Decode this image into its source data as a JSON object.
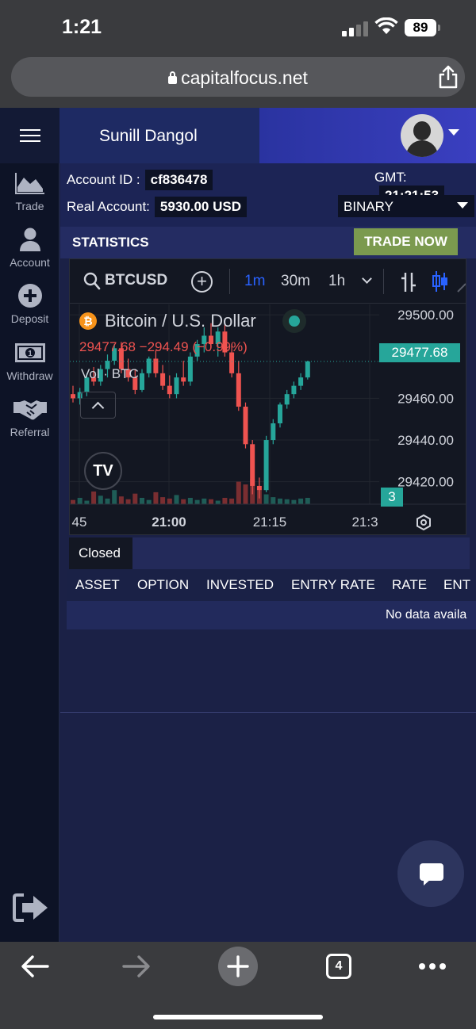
{
  "status_bar": {
    "time": "1:21",
    "battery": "89"
  },
  "browser": {
    "url": "capitalfocus.net"
  },
  "header": {
    "user_name": "Sunill Dangol"
  },
  "sidebar": {
    "items": [
      {
        "label": "Trade",
        "icon": "chart-area-icon"
      },
      {
        "label": "Account",
        "icon": "user-icon"
      },
      {
        "label": "Deposit",
        "icon": "plus-circle-icon"
      },
      {
        "label": "Withdraw",
        "icon": "banknote-icon"
      },
      {
        "label": "Referral",
        "icon": "handshake-icon"
      }
    ],
    "logout_icon": "logout-icon"
  },
  "account": {
    "id_label": "Account ID :",
    "id_value": "cf836478",
    "gmt_label": "GMT:",
    "gmt_value": "21:21:53",
    "real_label": "Real Account:",
    "real_value": "5930.00 USD",
    "mode": "BINARY"
  },
  "stats": {
    "title": "STATISTICS",
    "trade_now": "TRADE NOW"
  },
  "tv_toolbar": {
    "symbol": "BTCUSD",
    "intervals": [
      "1m",
      "30m",
      "1h"
    ],
    "active_interval": "1m"
  },
  "chart_data": {
    "type": "candlestick",
    "title": "Bitcoin / U.S. Dollar",
    "last_price": "29477.68",
    "change": "−294.49",
    "change_pct": "(−0.99%)",
    "volume_label": "Vol · BTC",
    "y_ticks": [
      "29500.00",
      "29460.00",
      "29440.00",
      "29420.00"
    ],
    "x_ticks": [
      "45",
      "21:00",
      "21:15",
      "21:3"
    ],
    "volume_badge": "3",
    "colors": {
      "up": "#26a69a",
      "down": "#ef5350"
    },
    "candles": [
      {
        "o": 29462,
        "h": 29466,
        "l": 29458,
        "c": 29460
      },
      {
        "o": 29460,
        "h": 29465,
        "l": 29457,
        "c": 29463
      },
      {
        "o": 29463,
        "h": 29472,
        "l": 29461,
        "c": 29470
      },
      {
        "o": 29470,
        "h": 29475,
        "l": 29466,
        "c": 29468
      },
      {
        "o": 29468,
        "h": 29476,
        "l": 29466,
        "c": 29474
      },
      {
        "o": 29474,
        "h": 29481,
        "l": 29470,
        "c": 29478
      },
      {
        "o": 29478,
        "h": 29486,
        "l": 29476,
        "c": 29484
      },
      {
        "o": 29484,
        "h": 29487,
        "l": 29472,
        "c": 29474
      },
      {
        "o": 29474,
        "h": 29479,
        "l": 29468,
        "c": 29470
      },
      {
        "o": 29470,
        "h": 29474,
        "l": 29462,
        "c": 29464
      },
      {
        "o": 29464,
        "h": 29474,
        "l": 29463,
        "c": 29472
      },
      {
        "o": 29472,
        "h": 29480,
        "l": 29470,
        "c": 29479
      },
      {
        "o": 29479,
        "h": 29483,
        "l": 29470,
        "c": 29472
      },
      {
        "o": 29472,
        "h": 29476,
        "l": 29464,
        "c": 29466
      },
      {
        "o": 29466,
        "h": 29471,
        "l": 29460,
        "c": 29462
      },
      {
        "o": 29462,
        "h": 29472,
        "l": 29460,
        "c": 29470
      },
      {
        "o": 29470,
        "h": 29478,
        "l": 29466,
        "c": 29468
      },
      {
        "o": 29468,
        "h": 29482,
        "l": 29466,
        "c": 29480
      },
      {
        "o": 29480,
        "h": 29488,
        "l": 29478,
        "c": 29486
      },
      {
        "o": 29486,
        "h": 29494,
        "l": 29482,
        "c": 29490
      },
      {
        "o": 29490,
        "h": 29496,
        "l": 29484,
        "c": 29486
      },
      {
        "o": 29486,
        "h": 29494,
        "l": 29480,
        "c": 29492
      },
      {
        "o": 29492,
        "h": 29496,
        "l": 29480,
        "c": 29482
      },
      {
        "o": 29482,
        "h": 29486,
        "l": 29470,
        "c": 29472
      },
      {
        "o": 29472,
        "h": 29478,
        "l": 29454,
        "c": 29456
      },
      {
        "o": 29456,
        "h": 29458,
        "l": 29436,
        "c": 29438
      },
      {
        "o": 29438,
        "h": 29440,
        "l": 29414,
        "c": 29418
      },
      {
        "o": 29418,
        "h": 29422,
        "l": 29412,
        "c": 29416
      },
      {
        "o": 29416,
        "h": 29442,
        "l": 29415,
        "c": 29440
      },
      {
        "o": 29440,
        "h": 29450,
        "l": 29438,
        "c": 29448
      },
      {
        "o": 29448,
        "h": 29458,
        "l": 29446,
        "c": 29457
      },
      {
        "o": 29457,
        "h": 29464,
        "l": 29455,
        "c": 29462
      },
      {
        "o": 29462,
        "h": 29468,
        "l": 29460,
        "c": 29466
      },
      {
        "o": 29466,
        "h": 29472,
        "l": 29464,
        "c": 29470
      },
      {
        "o": 29470,
        "h": 29478,
        "l": 29469,
        "c": 29477.68
      }
    ],
    "volumes": [
      0.6,
      0.9,
      0.5,
      1.8,
      1.2,
      0.8,
      2.0,
      1.1,
      0.7,
      1.5,
      0.9,
      0.6,
      1.7,
      1.0,
      0.8,
      1.3,
      0.7,
      0.9,
      0.6,
      0.8,
      0.7,
      0.5,
      0.9,
      0.8,
      3.2,
      2.8,
      3.6,
      2.0,
      1.4,
      1.0,
      0.8,
      0.7,
      0.6,
      0.8,
      0.9
    ]
  },
  "closed": {
    "tab": "Closed",
    "columns": [
      "ASSET",
      "OPTION",
      "INVESTED",
      "ENTRY RATE",
      "RATE",
      "ENT"
    ],
    "empty_message": "No data availa"
  },
  "bottom_bar": {
    "tab_count": "4"
  }
}
